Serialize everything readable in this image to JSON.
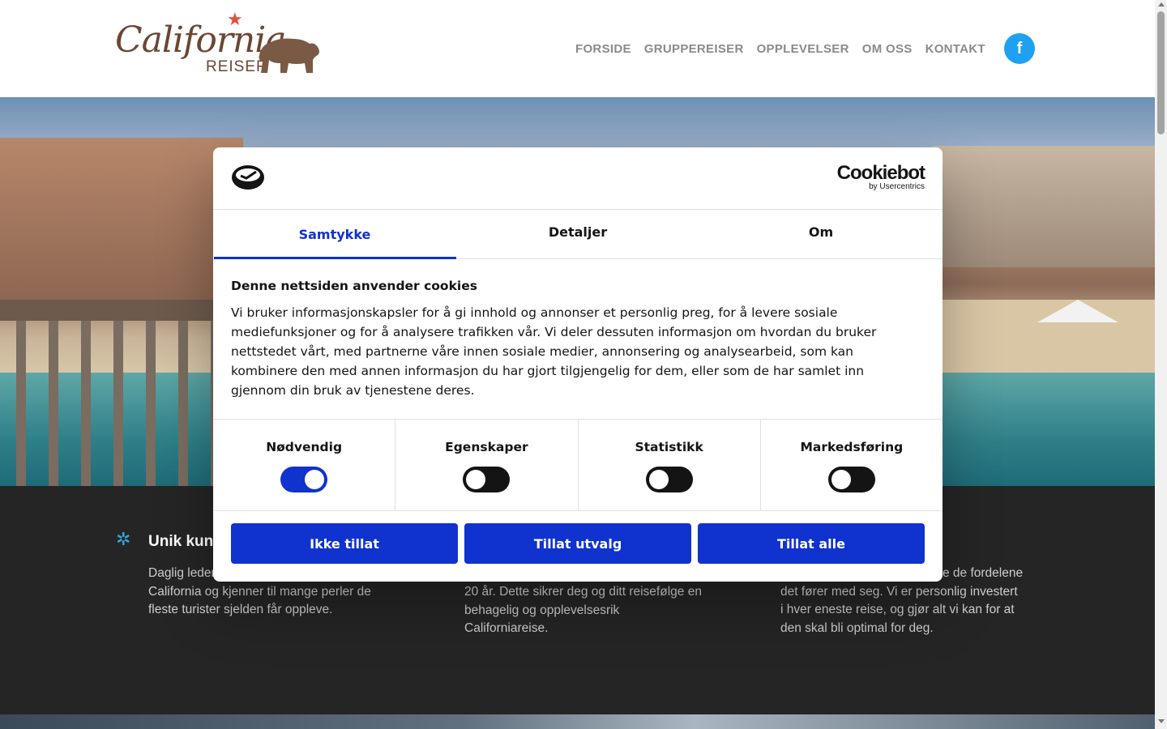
{
  "header": {
    "logo": {
      "main": "California",
      "sub": "REISER"
    },
    "nav": [
      "FORSIDE",
      "GRUPPEREISER",
      "OPPLEVELSER",
      "OM OSS",
      "KONTAKT"
    ],
    "facebook_icon": "facebook-f"
  },
  "features": [
    {
      "icon": "palm-tree-icon",
      "title": "Unik kun",
      "text": "Daglig leder",
      "text_lines": [
        "California og kjenner til mange perler de",
        "fleste turister sjelden får oppleve."
      ]
    },
    {
      "text_lines": [
        "20 år. Dette sikrer deg og ditt reisefølge en",
        "behagelig og opplevelsesrik",
        "Californiareise."
      ]
    },
    {
      "text_lines": [
        "e de fordelene",
        "det fører med seg. Vi er personlig investert",
        "i hver eneste reise, og gjør alt vi kan for at",
        "den skal bli optimal for deg."
      ]
    }
  ],
  "cookie_dialog": {
    "brand": {
      "main": "Cookiebot",
      "sub": "by Usercentrics"
    },
    "tabs": [
      "Samtykke",
      "Detaljer",
      "Om"
    ],
    "active_tab": "Samtykke",
    "title": "Denne nettsiden anvender cookies",
    "body": "Vi bruker informasjonskapsler for å gi innhold og annonser et personlig preg, for å levere sosiale mediefunksjoner og for å analysere trafikken vår. Vi deler dessuten informasjon om hvordan du bruker nettstedet vårt, med partnerne våre innen sosiale medier, annonsering og analysearbeid, som kan kombinere den med annen informasjon du har gjort tilgjengelig for dem, eller som de har samlet inn gjennom din bruk av tjenestene deres.",
    "toggles": [
      {
        "label": "Nødvendig",
        "on": true
      },
      {
        "label": "Egenskaper",
        "on": false
      },
      {
        "label": "Statistikk",
        "on": false
      },
      {
        "label": "Markedsføring",
        "on": false
      }
    ],
    "buttons": [
      "Ikke tillat",
      "Tillat utvalg",
      "Tillat alle"
    ]
  },
  "colors": {
    "accent": "#1032cf",
    "facebook": "#1ea1f2",
    "brand_brown": "#6b4633",
    "dark_section": "#252525"
  }
}
